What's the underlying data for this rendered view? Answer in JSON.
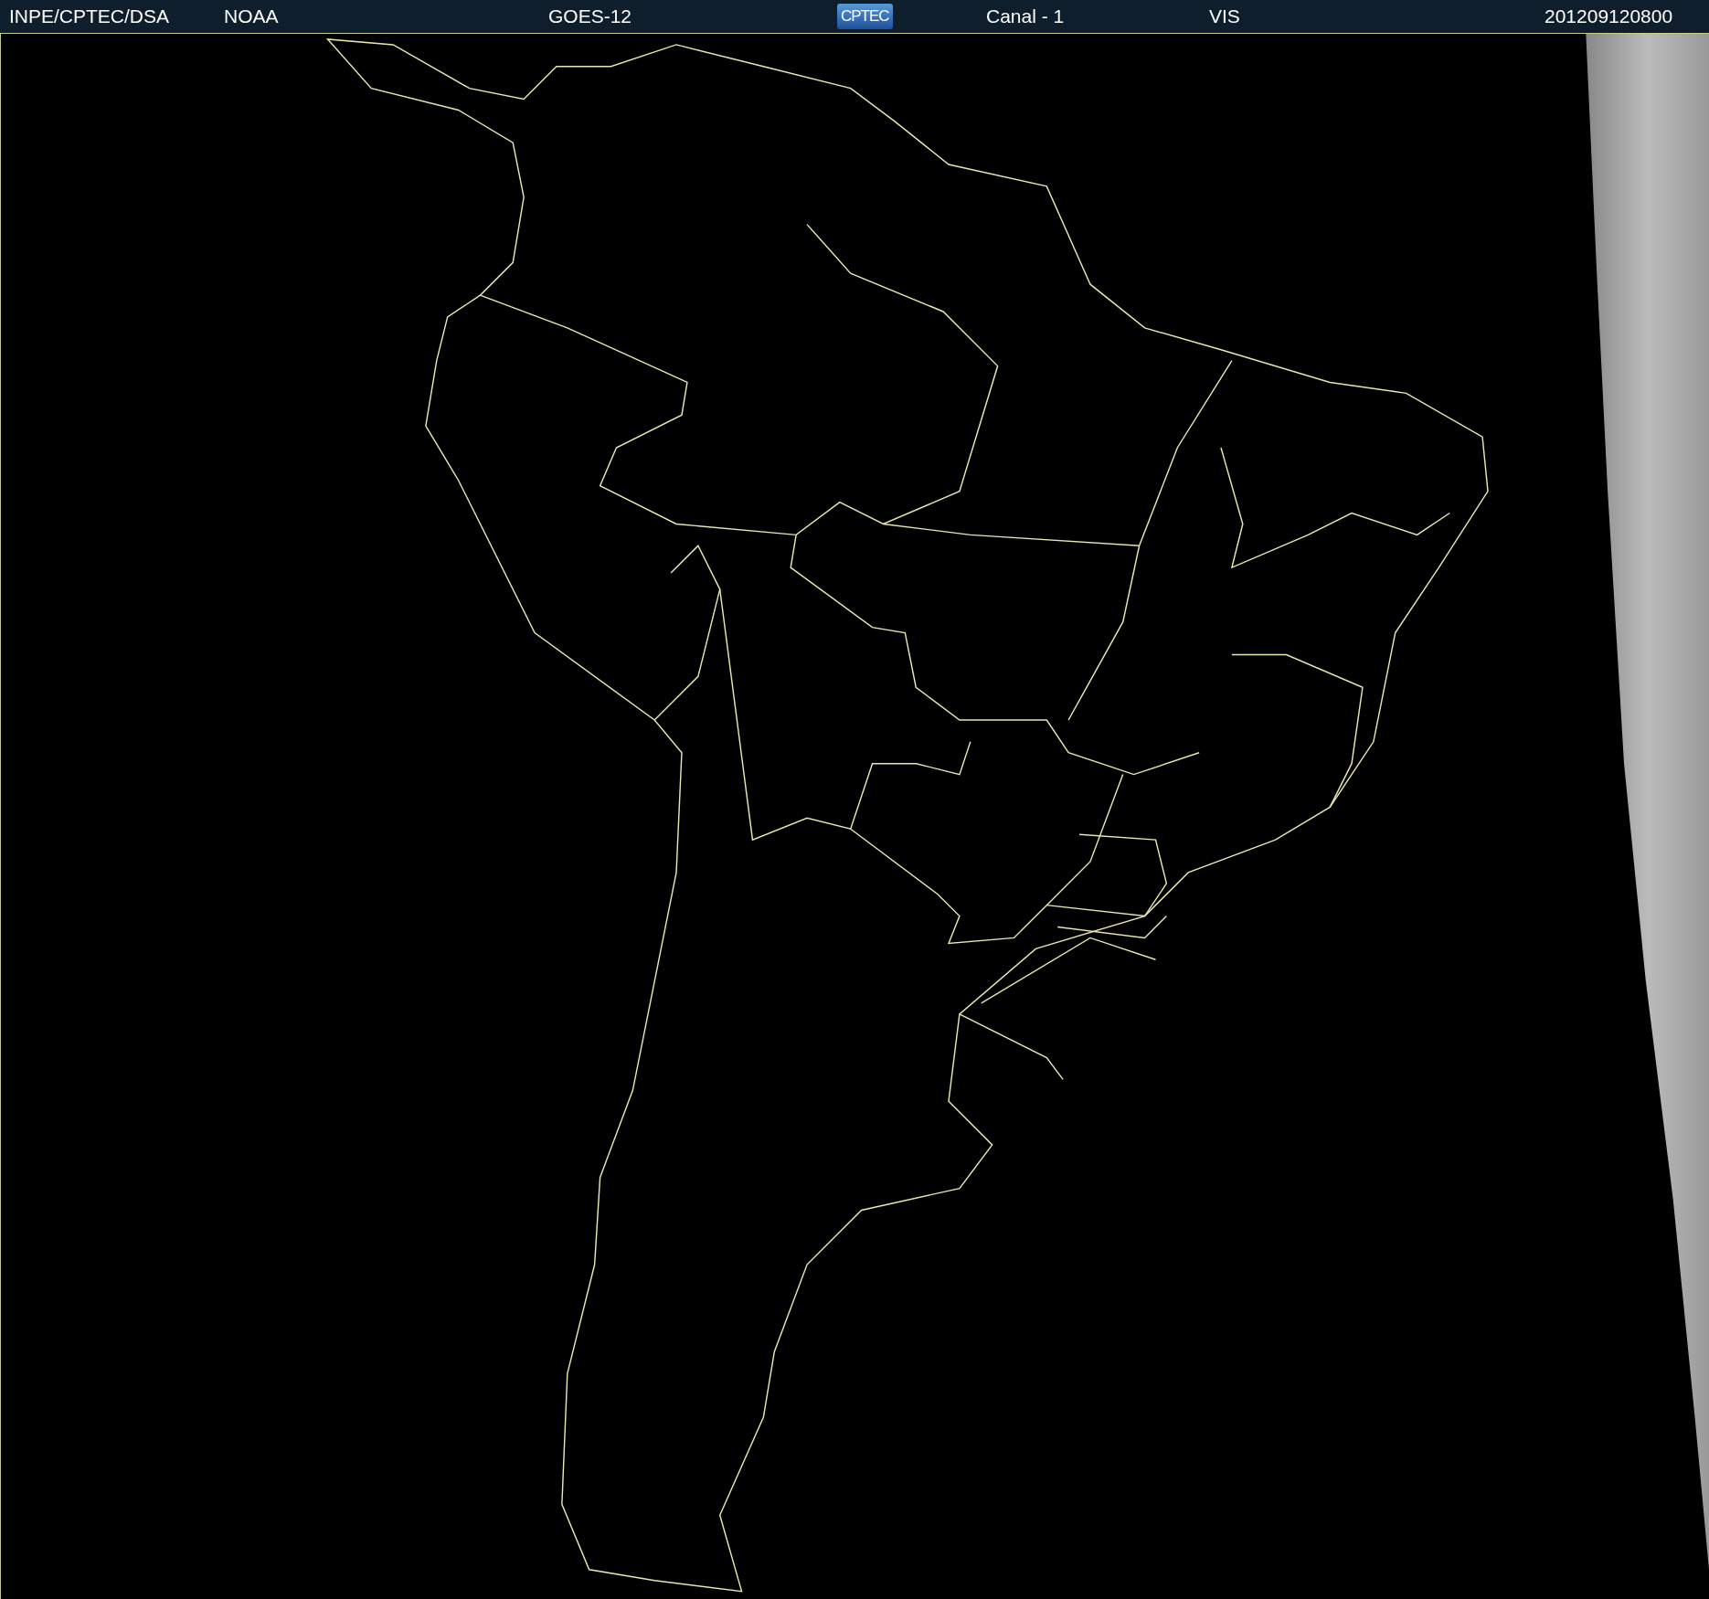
{
  "header": [
    {
      "kind": "text",
      "text": "INPE/CPTEC/DSA"
    },
    {
      "kind": "text",
      "text": "NOAA"
    },
    {
      "kind": "text",
      "text": "GOES-12"
    },
    {
      "kind": "logo",
      "text": "CPTEC"
    },
    {
      "kind": "text",
      "text": "Canal - 1"
    },
    {
      "kind": "text",
      "text": "VIS"
    },
    {
      "kind": "text",
      "text": "201209120800"
    }
  ]
}
